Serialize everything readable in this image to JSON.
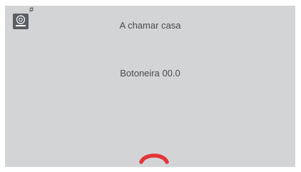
{
  "header": {
    "device_icon": "intercom-panel-icon",
    "hash_indicator": "#"
  },
  "call": {
    "status_text": "A chamar casa",
    "source_name": "Botoneira 00.0"
  },
  "actions": {
    "hangup_icon": "phone-hangup-icon",
    "hangup_color": "#e5353a"
  },
  "colors": {
    "screen_background": "#d3d4d5",
    "text": "#4a4a4a",
    "icon_background": "#5a5d63"
  }
}
